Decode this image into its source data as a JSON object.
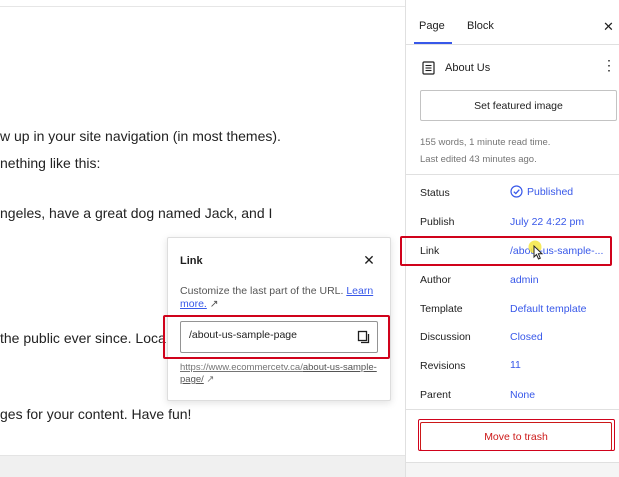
{
  "editor": {
    "lines": [
      "w up in your site navigation (in most themes).",
      "nething like this:",
      "ngeles, have a great dog named Jack, and I",
      "the public ever since. Loca",
      "ges for your content. Have fun!"
    ]
  },
  "link_popover": {
    "title": "Link",
    "close_glyph": "✕",
    "help_text": "Customize the last part of the URL.",
    "learn_more_label": "Learn more.",
    "learn_more_arrow": "↗",
    "slug_value": "/about-us-sample-page",
    "url_base": "https://www.ecommercetv.ca/",
    "url_slug": "about-us-sample-page/",
    "url_arrow": "↗"
  },
  "sidebar": {
    "tabs": [
      {
        "label": "Page",
        "active": true
      },
      {
        "label": "Block",
        "active": false
      }
    ],
    "close_glyph": "✕",
    "document_title": "About Us",
    "more_glyph": "⋮",
    "featured_image_label": "Set featured image",
    "word_count_text": "155 words, 1 minute read time.",
    "last_edited_text": "Last edited 43 minutes ago.",
    "properties": {
      "status": {
        "label": "Status",
        "value": "Published"
      },
      "publish": {
        "label": "Publish",
        "value": "July 22 4:22 pm"
      },
      "link": {
        "label": "Link",
        "value": "/about-us-sample-..."
      },
      "author": {
        "label": "Author",
        "value": "admin"
      },
      "template": {
        "label": "Template",
        "value": "Default template"
      },
      "discussion": {
        "label": "Discussion",
        "value": "Closed"
      },
      "revisions": {
        "label": "Revisions",
        "value": "11"
      },
      "parent": {
        "label": "Parent",
        "value": "None"
      }
    },
    "trash_label": "Move to trash"
  },
  "colors": {
    "accent": "#3858e9",
    "highlight_red": "#d0021b",
    "destructive": "#cc1818",
    "cursor_highlight": "#f5e642"
  },
  "icons": [
    "close-icon",
    "copy-icon",
    "external-link-icon",
    "page-icon",
    "more-vertical-icon",
    "published-check-icon",
    "pointer-cursor-icon"
  ]
}
